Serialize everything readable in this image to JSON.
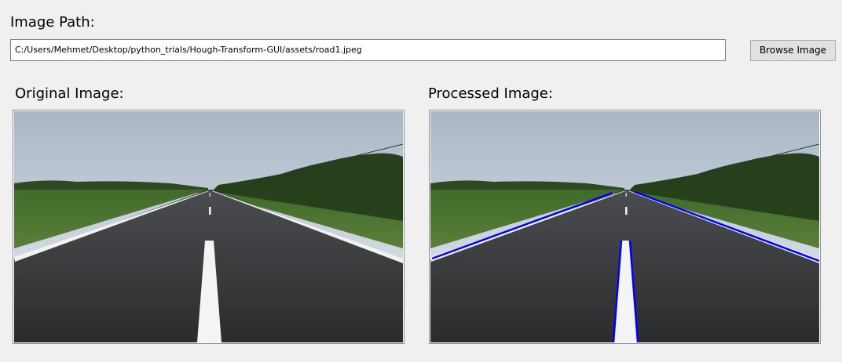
{
  "image_path": {
    "label": "Image Path:",
    "value": "C:/Users/Mehmet/Desktop/python_trials/Hough-Transform-GUI/assets/road1.jpeg",
    "browse_label": "Browse Image"
  },
  "original": {
    "label": "Original Image:"
  },
  "processed": {
    "label": "Processed Image:"
  },
  "colors": {
    "detected_line": "#0000ff",
    "window_bg": "#f0f0f0"
  }
}
